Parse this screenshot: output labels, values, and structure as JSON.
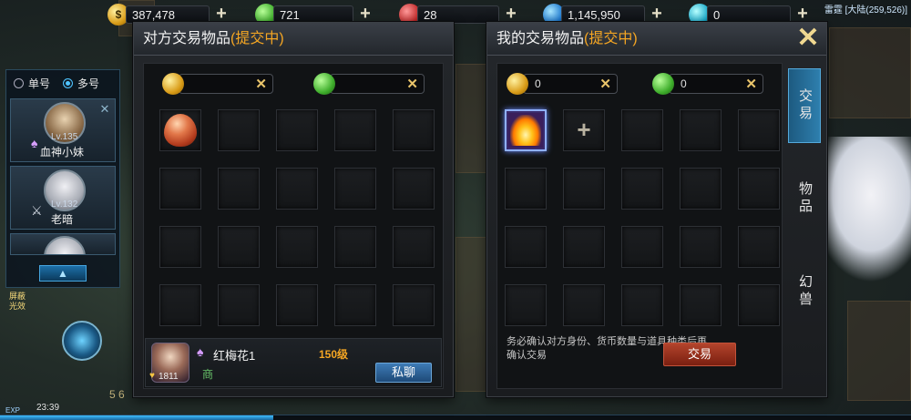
{
  "currencies": [
    {
      "name": "gold-coin",
      "value": "387,478",
      "color": "#d99c18",
      "icon": "gold-coin-icon"
    },
    {
      "name": "green-jade",
      "value": "721",
      "color": "#3fae2c",
      "icon": "green-jade-icon"
    },
    {
      "name": "red-gem",
      "value": "28",
      "color": "#c02a2a",
      "icon": "red-gem-icon"
    },
    {
      "name": "blue-diamond",
      "value": "1,145,950",
      "color": "#1e7ad0",
      "icon": "blue-diamond-icon"
    },
    {
      "name": "cyan-orb",
      "value": "0",
      "color": "#1aa9c9",
      "icon": "cyan-orb-icon"
    }
  ],
  "region": "雷霆 [大陆(259,526)]",
  "party": {
    "mode_single": "单号",
    "mode_multi": "多号",
    "members": [
      {
        "level": "Lv.135",
        "name": "血神小妹"
      },
      {
        "level": "Lv.132",
        "name": "老暗"
      }
    ]
  },
  "shield_text": "屏蔽光效",
  "exp_label": "EXP",
  "clock": "23:39",
  "bottom_numbers": "5 6",
  "other_window": {
    "title": "对方交易物品",
    "status": "(提交中)",
    "money": [
      {
        "type": "gold",
        "value": ""
      },
      {
        "type": "green",
        "value": ""
      }
    ],
    "items": [
      "egg"
    ],
    "player": {
      "name": "红梅花1",
      "level": "150级",
      "merchant": "商",
      "avatar_level": "1811",
      "chat_button": "私聊"
    }
  },
  "my_window": {
    "title": "我的交易物品",
    "status": "(提交中)",
    "money": [
      {
        "type": "gold",
        "value": "0"
      },
      {
        "type": "green",
        "value": "0"
      }
    ],
    "tabs": [
      {
        "label": "交易",
        "active": true
      },
      {
        "label": "物品",
        "active": false
      },
      {
        "label": "幻兽",
        "active": false
      }
    ],
    "notice": "务必确认对方身份、货币数量与道具种类后再确认交易",
    "trade_button": "交易"
  }
}
